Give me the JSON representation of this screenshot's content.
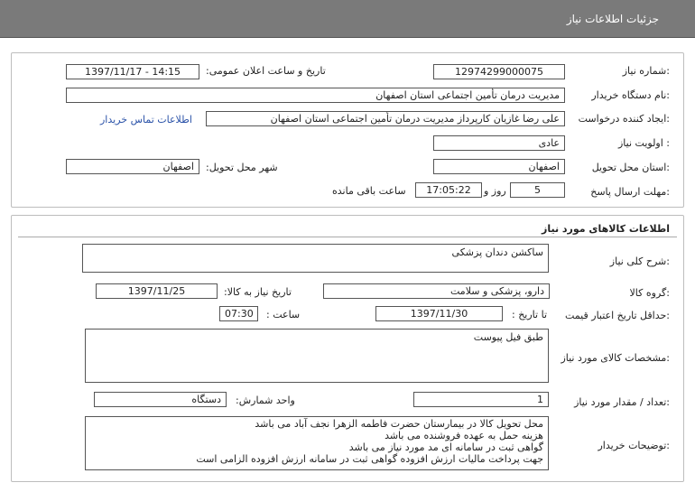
{
  "header": {
    "title": "جزئیات اطلاعات نیاز"
  },
  "info": {
    "need_number_label": "شماره نیاز:",
    "need_number": "12974299000075",
    "announce_label": "تاریخ و ساعت اعلان عمومی:",
    "announce_value": "1397/11/17 - 14:15",
    "buyer_label": "نام دستگاه خریدار:",
    "buyer_value": "مدیریت درمان تأمین اجتماعی استان اصفهان",
    "creator_label": "ایجاد کننده درخواست:",
    "creator_value": "علی رضا غازیان کارپرداز مدیریت درمان تأمین اجتماعی استان اصفهان",
    "contact_link": "اطلاعات تماس خریدار",
    "priority_label": "اولویت نیاز :",
    "priority_value": "عادی",
    "province_label": "استان محل تحویل:",
    "province_value": "اصفهان",
    "city_label": "شهر محل تحویل:",
    "city_value": "اصفهان",
    "deadline_label": "مهلت ارسال پاسخ:",
    "days_value": "5",
    "days_and": "روز و",
    "time_value": "17:05:22",
    "remaining_label": "ساعت باقی مانده"
  },
  "goods": {
    "section_title": "اطلاعات کالاهای مورد نیاز",
    "desc_label": "شرح کلی نیاز:",
    "desc_value": "ساکشن دندان پزشکی",
    "group_label": "گروه کالا:",
    "group_value": "دارو، پزشکی و سلامت",
    "need_date_label": "تاریخ نیاز به کالا:",
    "need_date_value": "1397/11/25",
    "validity_label": "حداقل تاریخ اعتبار قیمت:",
    "until_date_label": "تا تاریخ :",
    "until_date_value": "1397/11/30",
    "hour_label": "ساعت :",
    "hour_value": "07:30",
    "specs_label": "مشخصات کالای مورد نیاز:",
    "specs_value": "طبق فیل پیوست",
    "qty_label": "تعداد / مقدار مورد نیاز:",
    "qty_value": "1",
    "unit_label": "واحد شمارش:",
    "unit_value": "دستگاه",
    "notes_label": "توضیحات خریدار:",
    "notes_lines": [
      "محل تحویل کالا در بیمارستان حضرت فاطمه الزهرا نجف آباد می باشد",
      "هزینه حمل به عهده فروشنده می باشد",
      "گواهی ثبت در سامانه ای مد مورد نیاز می باشد",
      "جهت پرداخت مالیات ارزش افزوده گواهی ثبت در سامانه ارزش افزوده الزامی است"
    ]
  }
}
